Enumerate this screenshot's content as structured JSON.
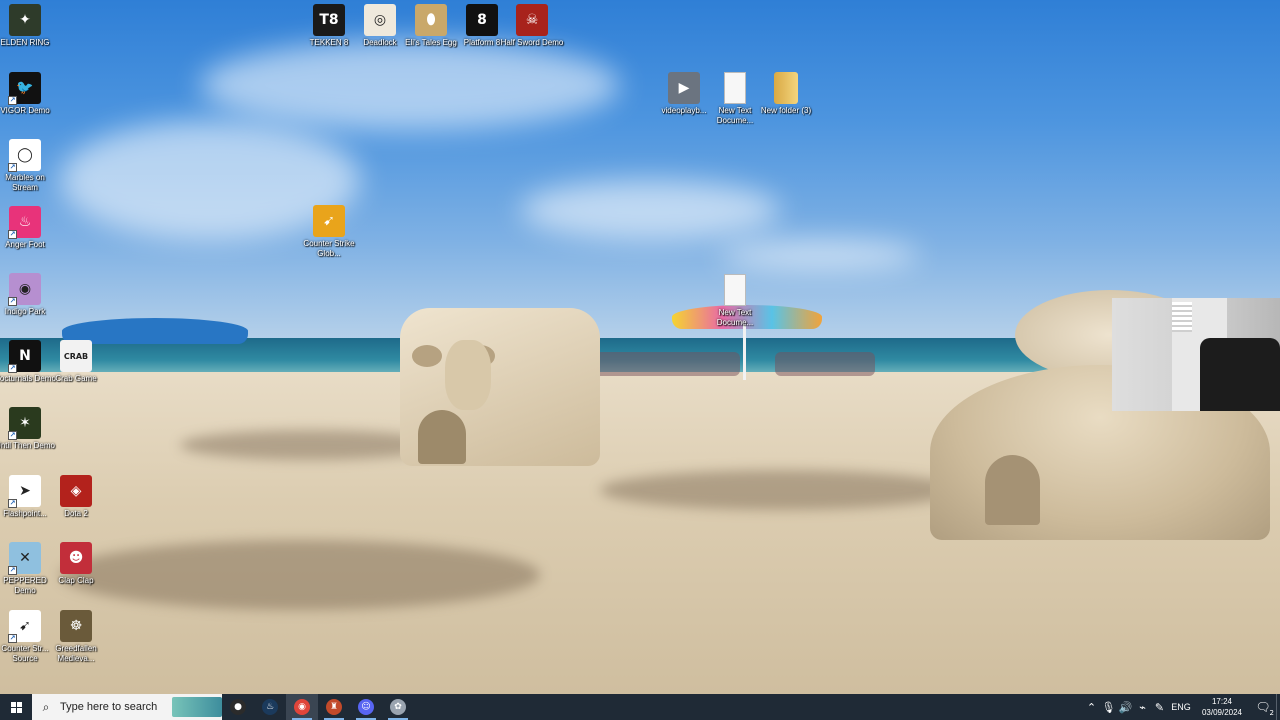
{
  "desktop": {
    "icons": [
      {
        "id": "elden-ring",
        "label": "ELDEN RING",
        "icon": "elden-ring-icon",
        "color": "#2e3b2a",
        "glyph": "✦",
        "shortcut": false
      },
      {
        "id": "vigor",
        "label": "VIGOR Demo",
        "icon": "vigor-icon",
        "color": "#111111",
        "glyph": "🐦",
        "shortcut": true
      },
      {
        "id": "marbles",
        "label": "Marbles on Stream",
        "icon": "marbles-icon",
        "color": "#ffffff",
        "glyph": "◯",
        "shortcut": true
      },
      {
        "id": "anger-foot",
        "label": "Anger Foot",
        "icon": "anger-foot-icon",
        "color": "#e8337a",
        "glyph": "♨",
        "shortcut": true
      },
      {
        "id": "indigo-park",
        "label": "Indigo Park",
        "icon": "indigo-park-icon",
        "color": "#b68fd0",
        "glyph": "◉",
        "shortcut": true
      },
      {
        "id": "nocturnals",
        "label": "Nocturnals Demo",
        "icon": "nocturnals-icon",
        "color": "#111111",
        "glyph": "N",
        "shortcut": true
      },
      {
        "id": "crab-game",
        "label": "Crab Game",
        "icon": "crab-game-icon",
        "color": "#f2f2f2",
        "glyph": "CRAB",
        "shortcut": false
      },
      {
        "id": "until-then",
        "label": "Until Then Demo",
        "icon": "until-then-icon",
        "color": "#2a3a1e",
        "glyph": "✶",
        "shortcut": true
      },
      {
        "id": "flashpoint",
        "label": "Flashpoint...",
        "icon": "flashpoint-icon",
        "color": "#ffffff",
        "glyph": "➤",
        "shortcut": true
      },
      {
        "id": "dota2",
        "label": "Dota 2",
        "icon": "dota2-icon",
        "color": "#b3221c",
        "glyph": "◈",
        "shortcut": false
      },
      {
        "id": "peppered",
        "label": "PEPPERED Demo",
        "icon": "peppered-icon",
        "color": "#8fc0df",
        "glyph": "✕",
        "shortcut": true
      },
      {
        "id": "clap-clap",
        "label": "Clap Clap",
        "icon": "clap-clap-icon",
        "color": "#c22e3a",
        "glyph": "☻",
        "shortcut": false
      },
      {
        "id": "counter-strike-source",
        "label": "Counter Str... Source",
        "icon": "counter-strike-source-icon",
        "color": "#ffffff",
        "glyph": "➹",
        "shortcut": true
      },
      {
        "id": "greedfallen",
        "label": "Greedfallen Medieva...",
        "icon": "greedfallen-icon",
        "color": "#6a5a3a",
        "glyph": "☸",
        "shortcut": false
      },
      {
        "id": "tekken8",
        "label": "TEKKEN 8",
        "icon": "tekken8-icon",
        "color": "#1a1a1a",
        "glyph": "T8",
        "shortcut": false
      },
      {
        "id": "deadlock",
        "label": "Deadlock",
        "icon": "deadlock-icon",
        "color": "#efe9dc",
        "glyph": "◎",
        "shortcut": false
      },
      {
        "id": "elis-tales-egg",
        "label": "Eli's Tales Egg",
        "icon": "egg-icon",
        "color": "#c9a86a",
        "glyph": "⬮",
        "shortcut": false
      },
      {
        "id": "platform8",
        "label": "Platform 8",
        "icon": "platform8-icon",
        "color": "#111111",
        "glyph": "8",
        "shortcut": false
      },
      {
        "id": "half-sword",
        "label": "Half Sword Demo",
        "icon": "half-sword-icon",
        "color": "#a8231c",
        "glyph": "☠",
        "shortcut": false
      },
      {
        "id": "csgo",
        "label": "Counter Strike Glob...",
        "icon": "counter-strike-go-icon",
        "color": "#e9a41b",
        "glyph": "➹",
        "shortcut": false
      },
      {
        "id": "videoplayback",
        "label": "videoplayb...",
        "icon": "video-file-icon",
        "color": "#6b7480",
        "glyph": "▶",
        "shortcut": false
      },
      {
        "id": "new-text-doc-1",
        "label": "New Text Docume...",
        "icon": "text-document-icon",
        "color": "#f7f7f7",
        "glyph": "",
        "shortcut": false
      },
      {
        "id": "new-folder-3",
        "label": "New folder (3)",
        "icon": "folder-icon",
        "color": "#e7c36a",
        "glyph": "",
        "shortcut": false
      },
      {
        "id": "new-text-doc-2",
        "label": "New Text Docume...",
        "icon": "text-document-icon",
        "color": "#f7f7f7",
        "glyph": "",
        "shortcut": false
      }
    ]
  },
  "taskbar": {
    "search_placeholder": "Type here to search",
    "apps": [
      {
        "id": "obs",
        "icon": "obs-icon",
        "color": "#2b2b2b",
        "glyph": "●",
        "active": false,
        "running": false
      },
      {
        "id": "steam",
        "icon": "steam-icon",
        "color": "#1b3a5c",
        "glyph": "♨",
        "active": false,
        "running": false
      },
      {
        "id": "chrome",
        "icon": "chrome-icon",
        "color": "#e0453a",
        "glyph": "◉",
        "active": true,
        "running": true
      },
      {
        "id": "game-app",
        "icon": "game-app-icon",
        "color": "#c24a2a",
        "glyph": "♜",
        "active": false,
        "running": true
      },
      {
        "id": "discord",
        "icon": "discord-icon",
        "color": "#5865f2",
        "glyph": "☺",
        "active": false,
        "running": true
      },
      {
        "id": "capture-app",
        "icon": "capture-app-icon",
        "color": "#9aa4b0",
        "glyph": "✿",
        "active": false,
        "running": true
      }
    ],
    "tray": {
      "chevron": "chevron-up-icon",
      "lang": "ENG",
      "time": "17:24",
      "date": "03/09/2024",
      "notification_count": "2"
    }
  }
}
